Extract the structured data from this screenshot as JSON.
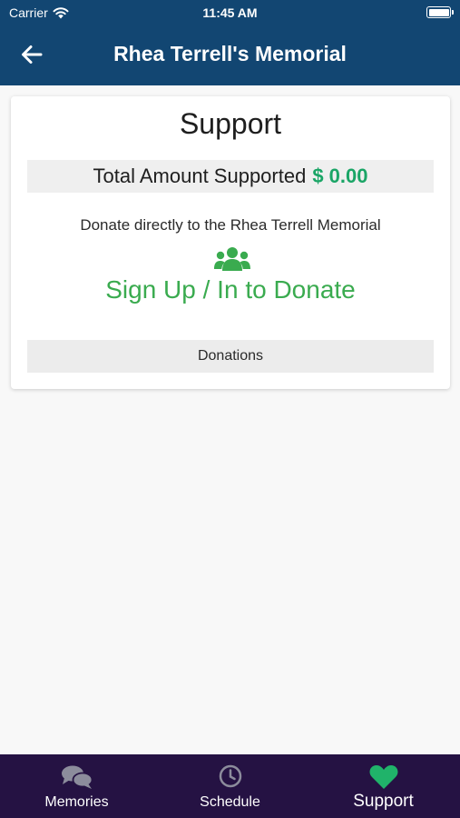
{
  "status_bar": {
    "carrier": "Carrier",
    "time": "11:45 AM"
  },
  "nav": {
    "title": "Rhea Terrell's Memorial",
    "back_icon": "arrow-left-icon"
  },
  "support": {
    "title": "Support",
    "total_label": "Total Amount Supported",
    "total_amount": "$ 0.00",
    "donate_text": "Donate directly to the Rhea Terrell Memorial",
    "group_icon": "users-icon",
    "signup_label": "Sign Up / In to Donate",
    "donations_label": "Donations"
  },
  "tabs": [
    {
      "label": "Memories",
      "icon": "chat-bubbles-icon",
      "active": false
    },
    {
      "label": "Schedule",
      "icon": "clock-icon",
      "active": false
    },
    {
      "label": "Support",
      "icon": "heart-icon",
      "active": true
    }
  ],
  "colors": {
    "header": "#124672",
    "tabbar": "#251243",
    "accent_green": "#3aab4f",
    "amount_green": "#1aa566",
    "active_tab_icon": "#20b36a",
    "inactive_tab_icon": "#8c8c9c"
  }
}
